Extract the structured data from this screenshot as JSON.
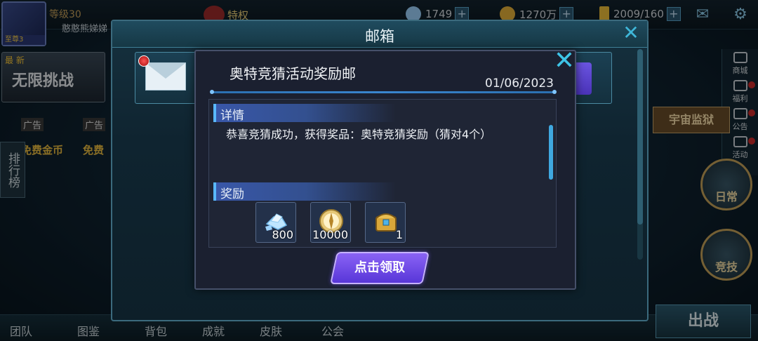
{
  "hud": {
    "player_level": "等级30",
    "player_name": "憨憨熊娣娣",
    "avatar_badge": "至尊3",
    "privilege_label": "特权",
    "resources": [
      {
        "icon": "gem-icon",
        "value": "1749"
      },
      {
        "icon": "gold-coin-icon",
        "value": "1270万"
      },
      {
        "icon": "energy-bolt-icon",
        "value": "2009/160"
      }
    ]
  },
  "left_side": {
    "banner_tag": "最 新",
    "banner_text": "无限挑战",
    "ads": [
      {
        "tag": "广告",
        "text": "免费金币"
      },
      {
        "tag": "广告",
        "text": "免费"
      }
    ],
    "rank_tab": "排行榜"
  },
  "right_side": {
    "menu": [
      {
        "label": "商城",
        "icon": "shop-cart-icon",
        "dot": false
      },
      {
        "label": "福利",
        "icon": "gift-icon",
        "dot": true
      },
      {
        "label": "公告",
        "icon": "announcement-icon",
        "dot": true
      },
      {
        "label": "活动",
        "icon": "event-icon",
        "dot": true
      }
    ],
    "cosmic_button": "宇宙监狱",
    "daily_label": "日常",
    "arena_label": "竞技"
  },
  "bottom_bar": {
    "items": [
      "团队",
      "图鉴",
      "背包",
      "成就",
      "皮肤",
      "公会"
    ],
    "sortie_label": "出战"
  },
  "mailbox": {
    "title": "邮箱"
  },
  "mail_detail": {
    "title": "奥特竞猜活动奖励邮",
    "date": "01/06/2023",
    "detail_section_label": "详情",
    "detail_text": "恭喜竞猜成功，获得奖品：奥特竞猜奖励（猜对4个）",
    "reward_section_label": "奖励",
    "rewards": [
      {
        "name": "crystal-icon",
        "quantity": "800"
      },
      {
        "name": "medal-icon",
        "quantity": "10000"
      },
      {
        "name": "treasure-chest-icon",
        "quantity": "1"
      }
    ],
    "claim_label": "点击领取"
  },
  "colors": {
    "accent_cyan": "#3ec4e8",
    "claim_purple": "#6a48e6",
    "section_blue": "#3957a8"
  }
}
